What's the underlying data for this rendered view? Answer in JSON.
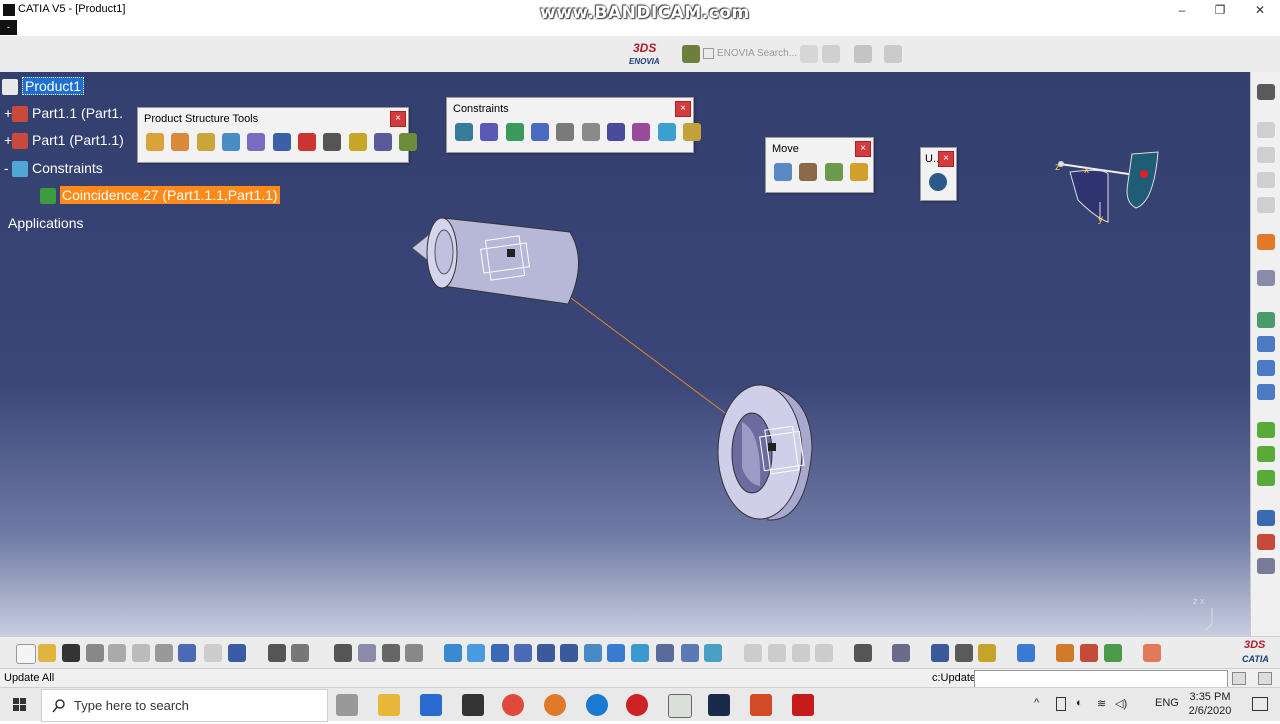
{
  "window": {
    "title": "CATIA V5 - [Product1]",
    "watermark": "www.BANDICAM.com",
    "min_glyph": "–",
    "max_glyph": "❐",
    "close_glyph": "✕",
    "sysmenu_glyph": "-"
  },
  "top_toolbar": {
    "enovia_ds": "3DS",
    "enovia_label": "ENOVIA",
    "enovia_search": "ENOVIA Search..."
  },
  "tree": {
    "root": "Product1",
    "part11": "Part1.1 (Part1.",
    "part1": "Part1 (Part1.1)",
    "constraints": "Constraints",
    "coincidence": "Coincidence.27 (Part1.1.1,Part1.1)",
    "applications": "Applications"
  },
  "toolbars": {
    "product_structure_tools": "Product Structure Tools",
    "constraints": "Constraints",
    "move": "Move",
    "update_short": "U..",
    "close_glyph": "×"
  },
  "compass": {
    "x": "x",
    "y": "y",
    "z": "z"
  },
  "axis_corner": {
    "label": "z x"
  },
  "status": {
    "message": "Update All",
    "command_label": "c:Update",
    "command_value": ""
  },
  "catia_logo": "CATIA",
  "taskbar": {
    "search_placeholder": "Type here to search",
    "lang": "ENG",
    "time": "3:35 PM",
    "date": "2/6/2020"
  }
}
